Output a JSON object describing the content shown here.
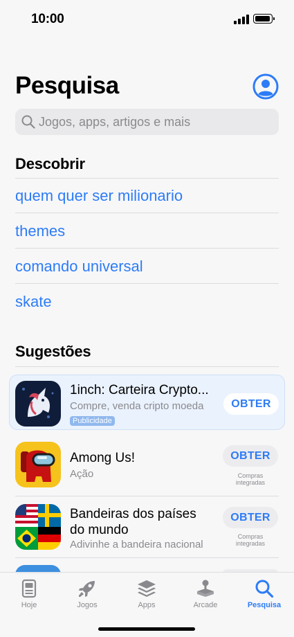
{
  "status": {
    "time": "10:00"
  },
  "header": {
    "title": "Pesquisa",
    "account_icon": "person-circle-icon"
  },
  "search": {
    "placeholder": "Jogos, apps, artigos e mais"
  },
  "discover": {
    "title": "Descobrir",
    "items": [
      "quem quer ser milionario",
      "themes",
      "comando universal",
      "skate"
    ]
  },
  "suggestions": {
    "title": "Sugestões",
    "apps": [
      {
        "name": "1inch: Carteira Crypto...",
        "subtitle": "Compre, venda cripto moeda",
        "badge": "Publicidade",
        "button": "OBTER"
      },
      {
        "name": "Among Us!",
        "subtitle": "Ação",
        "button": "OBTER",
        "note": "Compras integradas"
      },
      {
        "name_line1": "Bandeiras dos países",
        "name_line2": "do mundo",
        "subtitle": "Adivinhe a bandeira nacional",
        "button": "OBTER",
        "note": "Compras integradas"
      }
    ]
  },
  "tabs": [
    {
      "label": "Hoje",
      "icon": "today-icon"
    },
    {
      "label": "Jogos",
      "icon": "rocket-icon"
    },
    {
      "label": "Apps",
      "icon": "apps-stack-icon"
    },
    {
      "label": "Arcade",
      "icon": "joystick-icon"
    },
    {
      "label": "Pesquisa",
      "icon": "search-icon",
      "active": true
    }
  ],
  "colors": {
    "accent": "#2d7cf6",
    "secondary_text": "#8a8a8e",
    "ad_background": "#eaf2fd"
  }
}
